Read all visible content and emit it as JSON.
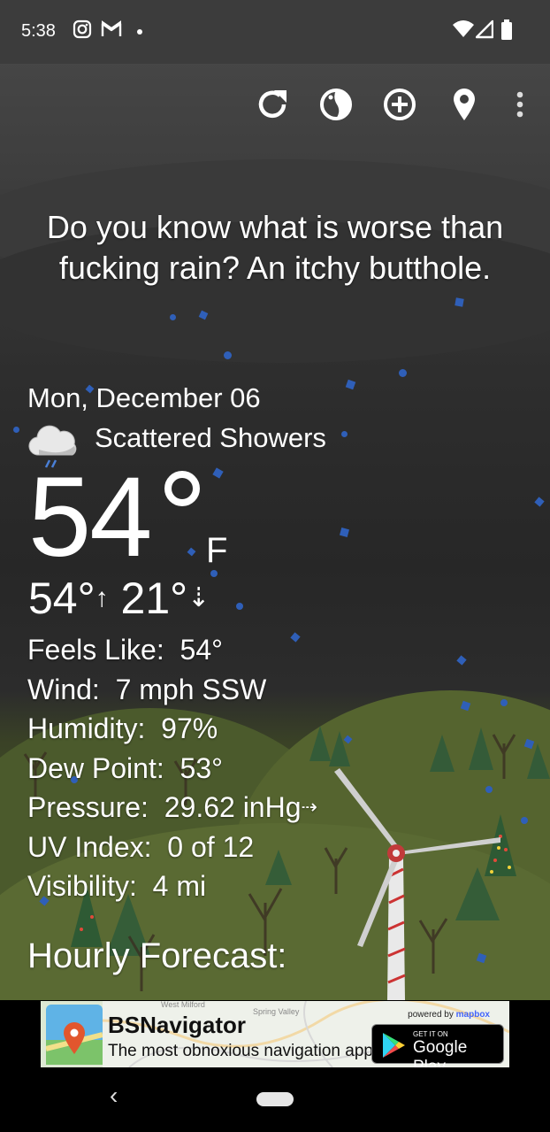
{
  "status_bar": {
    "time": "5:38",
    "icons": [
      "instagram-icon",
      "gmail-icon",
      "notification-dot-icon",
      "wifi-icon",
      "signal-icon",
      "battery-icon"
    ]
  },
  "toolbar": {
    "buttons": [
      "refresh-icon",
      "theme-icon",
      "add-location-icon",
      "location-pin-icon",
      "overflow-menu-icon"
    ]
  },
  "quote": "Do you know what is worse than fucking rain? An itchy butthole.",
  "current": {
    "date": "Mon, December 06",
    "condition": "Scattered Showers",
    "condition_icon": "rain-cloud-icon",
    "temperature": "54",
    "unit": "F",
    "high": "54°",
    "low": "21°",
    "high_arrow": "↑",
    "low_arrow": "⇣"
  },
  "details": [
    {
      "label": "Feels Like:",
      "value": "54°"
    },
    {
      "label": "Wind:",
      "value": "7 mph SSW"
    },
    {
      "label": "Humidity:",
      "value": "97%"
    },
    {
      "label": "Dew Point:",
      "value": "53°"
    },
    {
      "label": "Pressure:",
      "value": "29.62 inHg",
      "trend": "⇢"
    },
    {
      "label": "UV Index:",
      "value": "0 of 12"
    },
    {
      "label": "Visibility:",
      "value": "4 mi"
    }
  ],
  "hourly_heading": "Hourly Forecast:",
  "ad": {
    "title": "BSNavigator",
    "subtitle": "The most obnoxious navigation app.",
    "powered_by": "powered by",
    "powered_brand": "mapbox",
    "map_labels": [
      "West Milford",
      "Spring Valley"
    ],
    "store_small": "GET IT ON",
    "store_big": "Google Play"
  },
  "nav": {
    "back_glyph": "‹"
  },
  "colors": {
    "rain_drop": "#2f5fb8",
    "status_bar": "#3c3c3c",
    "text": "#ffffff"
  }
}
